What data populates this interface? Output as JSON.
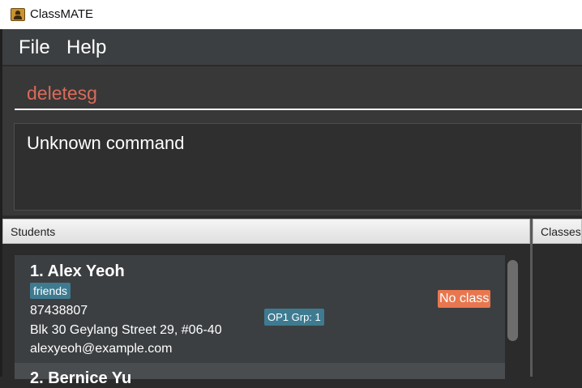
{
  "window": {
    "title": "ClassMATE"
  },
  "menu": {
    "items": [
      {
        "label": "File"
      },
      {
        "label": "Help"
      }
    ]
  },
  "command": {
    "value": "deletesg"
  },
  "result": {
    "message": "Unknown command"
  },
  "panes": {
    "students_title": "Students",
    "classes_title": "Classes"
  },
  "students": [
    {
      "index_name": "1.  Alex Yeoh",
      "tag": "friends",
      "phone": "87438807",
      "address": "Blk 30 Geylang Street 29, #06-40",
      "email": "alexyeoh@example.com",
      "group": "OP1 Grp: 1",
      "class_status": "No class"
    },
    {
      "index_name": "2.  Bernice Yu"
    }
  ],
  "colors": {
    "command_text": "#d96b5a",
    "tag_bg": "#3e7b91",
    "no_class_bg": "#e8774f",
    "card_bg": "#3c3f41"
  }
}
